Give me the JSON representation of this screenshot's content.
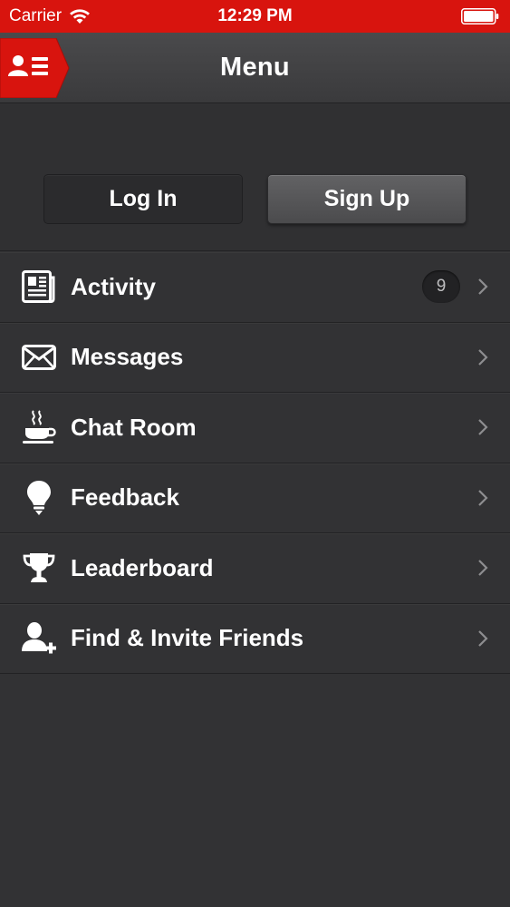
{
  "status_bar": {
    "carrier": "Carrier",
    "time": "12:29 PM"
  },
  "nav": {
    "title": "Menu",
    "accent_color": "#d8140e"
  },
  "auth": {
    "login_label": "Log In",
    "signup_label": "Sign Up"
  },
  "menu": {
    "items": [
      {
        "label": "Activity",
        "icon": "newspaper-icon",
        "badge": "9"
      },
      {
        "label": "Messages",
        "icon": "envelope-icon"
      },
      {
        "label": "Chat Room",
        "icon": "coffee-cup-icon"
      },
      {
        "label": "Feedback",
        "icon": "lightbulb-icon"
      },
      {
        "label": "Leaderboard",
        "icon": "trophy-icon"
      },
      {
        "label": "Find & Invite Friends",
        "icon": "add-user-icon"
      }
    ]
  }
}
